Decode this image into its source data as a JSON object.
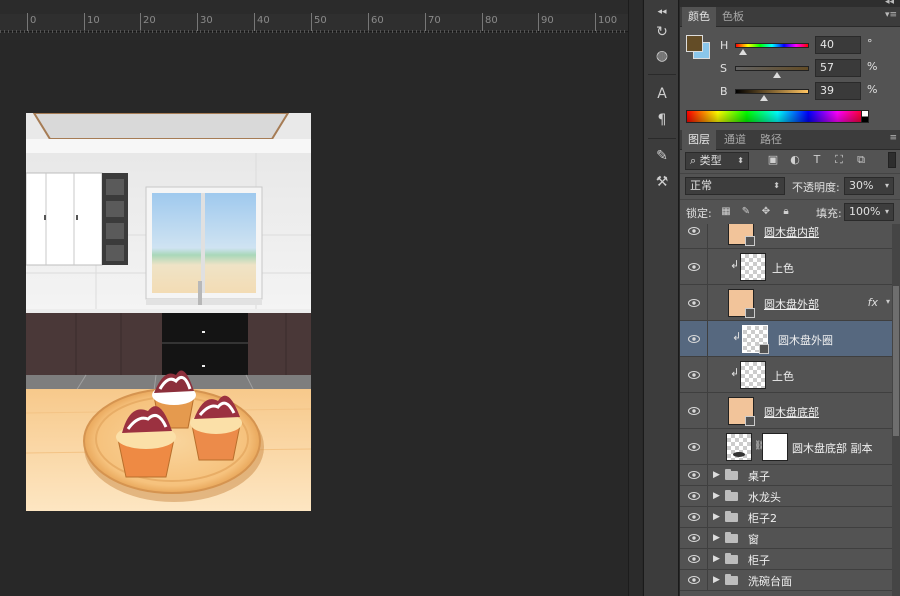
{
  "ruler": {
    "labels": [
      "0",
      "10",
      "20",
      "30",
      "40",
      "50",
      "60",
      "70",
      "80",
      "90",
      "100"
    ]
  },
  "color_panel": {
    "tabs": [
      "颜色",
      "色板"
    ],
    "foreground": "#634c26",
    "background": "#8ac6ea",
    "channels": [
      {
        "label": "H",
        "value": "40",
        "unit": "°",
        "fraction": 0.11
      },
      {
        "label": "S",
        "value": "57",
        "unit": "%",
        "fraction": 0.57
      },
      {
        "label": "B",
        "value": "39",
        "unit": "%",
        "fraction": 0.39
      }
    ]
  },
  "layers_panel": {
    "tabs": [
      "图层",
      "通道",
      "路径"
    ],
    "filter_kind": "类型",
    "blend_mode": "正常",
    "opacity_label": "不透明度:",
    "opacity_value": "30%",
    "lock_label": "锁定:",
    "fill_label": "填充:",
    "fill_value": "100%",
    "layers": [
      {
        "name": "圆木盘内部",
        "thumb": "beige",
        "smart": true,
        "clipped": false,
        "underline": true
      },
      {
        "name": "上色",
        "thumb": "checker",
        "clipped": true
      },
      {
        "name": "圆木盘外部",
        "thumb": "beige",
        "smart": true,
        "fx": "fx",
        "underline": true
      },
      {
        "name": "圆木盘外圈",
        "thumb": "checker",
        "smart": true,
        "clipped": true,
        "selected": true
      },
      {
        "name": "上色",
        "thumb": "checker",
        "clipped": true
      },
      {
        "name": "圆木盘底部",
        "thumb": "beige",
        "smart": true,
        "underline": true
      },
      {
        "name": "圆木盘底部 副本",
        "thumb": "checker",
        "mask": true
      }
    ],
    "groups": [
      "桌子",
      "水龙头",
      "柜子2",
      "窗",
      "柜子",
      "洗碗台面"
    ]
  }
}
